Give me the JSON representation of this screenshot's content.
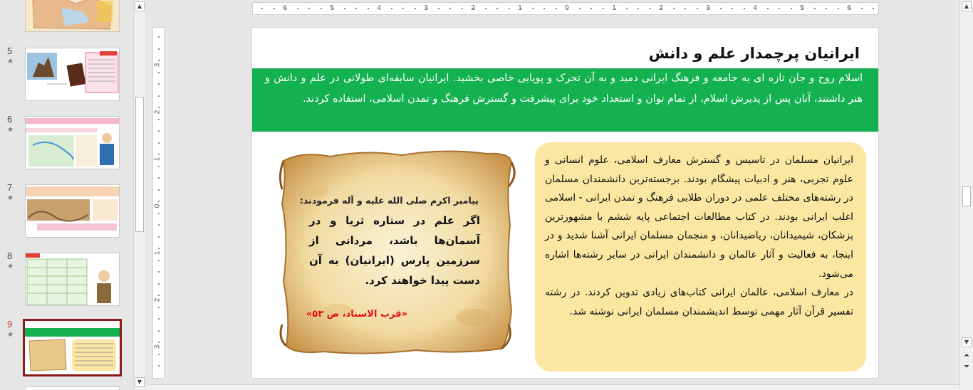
{
  "thumbnails": [
    {
      "number": "5",
      "star": "★"
    },
    {
      "number": "6",
      "star": "★"
    },
    {
      "number": "7",
      "star": "★"
    },
    {
      "number": "8",
      "star": "★"
    },
    {
      "number": "9",
      "star": "★",
      "active": true
    }
  ],
  "ruler": {
    "horizontal": [
      "6",
      "5",
      "4",
      "3",
      "2",
      "1",
      "0",
      "1",
      "2",
      "3",
      "4",
      "5",
      "6"
    ],
    "vertical": [
      "3",
      "2",
      "1",
      "0",
      "1",
      "2",
      "3"
    ]
  },
  "slide": {
    "title": "ایرانیان پرچمدار علم و دانش",
    "intro": "اسلام روح و جان تازه ای به جامعه و فرهنگ ایرانی دمید و به آن تحرک و پویایی خاصی بخشید. ایرانیان سابقه‌ای طولانی در علم و دانش و هنر داشتند، آنان پس از پذیرش اسلام، از تمام توان و استعداد خود برای پیشرفت و گسترش فرهنگ و تمدن اسلامی، استفاده کردند.",
    "body_p1": "ایرانیان مسلمان در تاسیس و گسترش معارف اسلامی، علوم انسانی و علوم تجربی، هنر و ادبیات پیشگام بودند. برجسته‌ترین دانشمندان مسلمان در رشته‌های مختلف علمی در دوران طلایی فرهنگ و تمدن ایرانی - اسلامی اغلب ایرانی بودند. در کتاب مطالعات اجتماعی پایه ششم با مشهورترین پزشکان، شیمیدانان، ریاضیدانان، و منجمان مسلمان ایرانی آشنا شدید و در اینجا، به فعالیت و آثار عالمان و دانشمندان ایرانی در سایر رشته‌ها اشاره می‌شود.",
    "body_p2": "در معارف اسلامی، عالمان ایرانی کتاب‌های زیادی تدوین کردند. در رشته تفسیر قرآن آثار مهمی توسط اندیشمندان مسلمان ایرانی نوشته شد.",
    "quote": {
      "heading": "پیامبر اکرم صلی الله علیه و آله فرمودند:",
      "text": "اگر علم در ستاره ثریا و در آسمان‌ها باشد، مردانی از سرزمین پارس (ایرانیان) به آن دست پیدا خواهند کرد.",
      "source": "«قرب الاسناد، ص ۵۳»"
    }
  },
  "colors": {
    "green_band": "#14b150",
    "yellow_box": "#fbe7a1",
    "active_border": "#8b1a1a",
    "source_red": "#e01010"
  }
}
